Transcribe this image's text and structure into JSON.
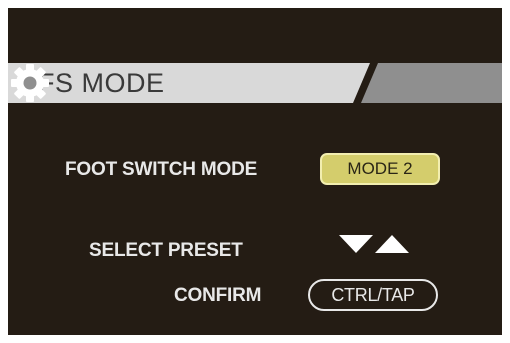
{
  "header": {
    "title": "FS MODE",
    "settings_icon": "gear-icon"
  },
  "foot_switch": {
    "label": "FOOT SWITCH MODE",
    "value": "MODE 2"
  },
  "select_preset": {
    "label": "SELECT PRESET",
    "icons": [
      "down-arrow-icon",
      "up-arrow-icon"
    ]
  },
  "confirm": {
    "label": "CONFIRM",
    "button_label": "CTRL/TAP"
  },
  "colors": {
    "screen_background": "#241c14",
    "title_bar_light": "#d9d9d9",
    "title_bar_dark": "#8f8f8f",
    "mode_button_fill": "#d4cd6c",
    "text": "#e8e8e8"
  }
}
